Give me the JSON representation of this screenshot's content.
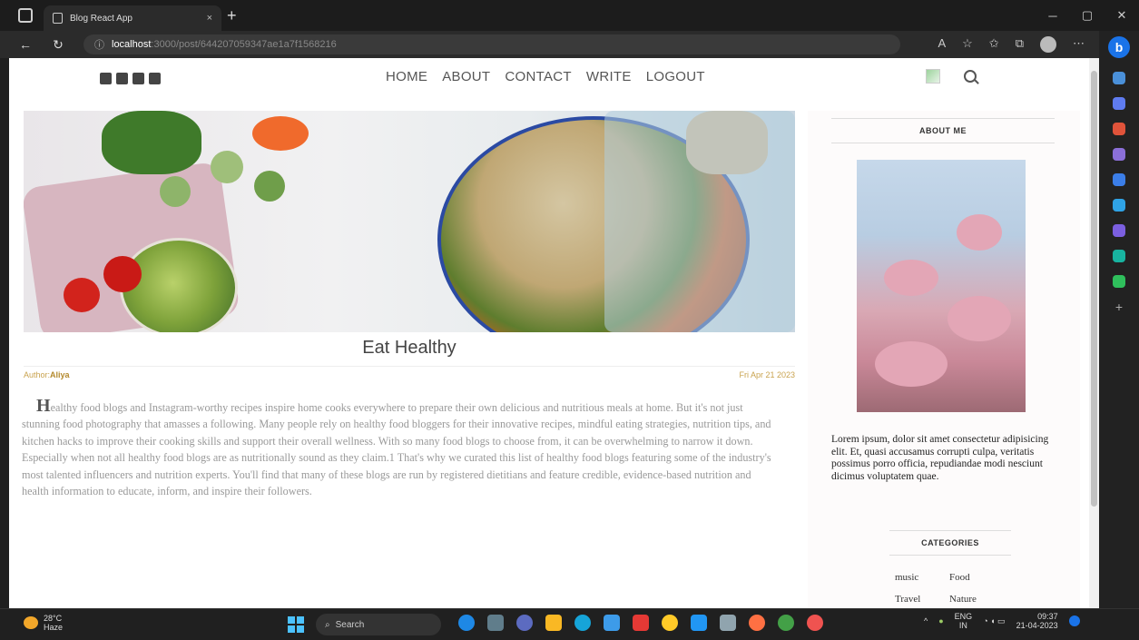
{
  "browser": {
    "tab_title": "Blog React App",
    "tab_close": "×",
    "new_tab": "+",
    "url_host": "localhost",
    "url_path": ":3000/post/644207059347ae1a7f1568216",
    "window_controls": [
      "─",
      "▢",
      "✕"
    ]
  },
  "site": {
    "menu": [
      "HOME",
      "ABOUT",
      "CONTACT",
      "WRITE",
      "LOGOUT"
    ],
    "social_icons": [
      "facebook-square-icon",
      "twitter-square-icon",
      "pinterest-square-icon",
      "instagram-square-icon"
    ]
  },
  "post": {
    "title": "Eat Healthy",
    "author_label": "Author:",
    "author": "Aliya",
    "date": "Fri Apr 21 2023",
    "drop_cap": "H",
    "description": "ealthy food blogs and Instagram-worthy recipes inspire home cooks everywhere to prepare their own delicious and nutritious meals at home. But it's not just stunning food photography that amasses a following. Many people rely on healthy food bloggers for their innovative recipes, mindful eating strategies, nutrition tips, and kitchen hacks to improve their cooking skills and support their overall wellness. With so many food blogs to choose from, it can be overwhelming to narrow it down. Especially when not all healthy food blogs are as nutritionally sound as they claim.1 That's why we curated this list of healthy food blogs featuring some of the industry's most talented influencers and nutrition experts. You'll find that many of these blogs are run by registered dietitians and feature credible, evidence-based nutrition and health information to educate, inform, and inspire their followers."
  },
  "sidebar": {
    "about_title": "ABOUT ME",
    "about_text": "Lorem ipsum, dolor sit amet consectetur adipisicing elit. Et, quasi accusamus corrupti culpa, veritatis possimus porro officia, repudiandae modi nesciunt dicimus voluptatem quae.",
    "categories_title": "CATEGORIES",
    "categories": [
      "music",
      "Food",
      "Travel",
      "Nature"
    ]
  },
  "taskbar": {
    "temp": "28°C",
    "weather": "Haze",
    "search": "Search",
    "lang1": "ENG",
    "lang2": "IN",
    "time": "09:37",
    "date": "21-04-2023"
  }
}
